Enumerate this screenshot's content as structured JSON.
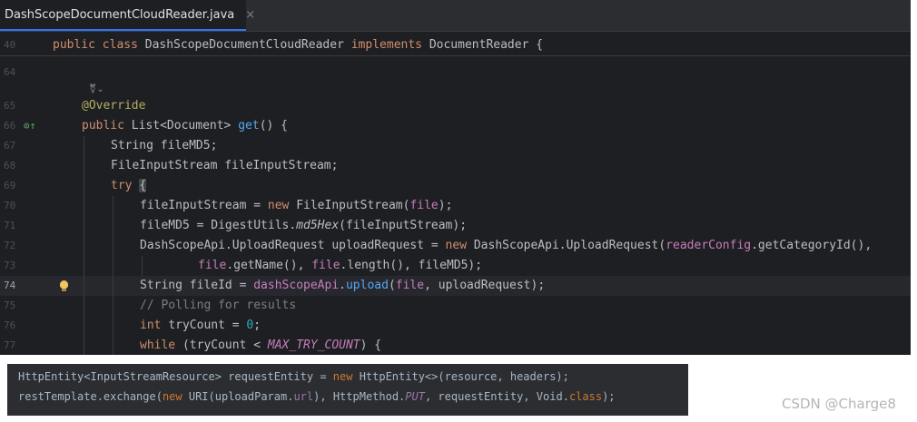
{
  "tab": {
    "title": "DashScopeDocumentCloudReader.java",
    "close": "×",
    "active": true
  },
  "sticky": {
    "line_no": "40",
    "code": "public class DashScopeDocumentCloudReader implements DocumentReader {"
  },
  "usages_hint": "⚧⌄",
  "current_line": "74",
  "lines": [
    {
      "no": "64",
      "code": ""
    },
    {
      "no": "65",
      "code": "@Override"
    },
    {
      "no": "66",
      "code": "public List<Document> get() {"
    },
    {
      "no": "67",
      "code": "String fileMD5;"
    },
    {
      "no": "68",
      "code": "FileInputStream fileInputStream;"
    },
    {
      "no": "69",
      "code": "try {"
    },
    {
      "no": "70",
      "code": "fileInputStream = new FileInputStream(file);"
    },
    {
      "no": "71",
      "code": "fileMD5 = DigestUtils.md5Hex(fileInputStream);"
    },
    {
      "no": "72",
      "code": "DashScopeApi.UploadRequest uploadRequest = new DashScopeApi.UploadRequest(readerConfig.getCategoryId(),"
    },
    {
      "no": "73",
      "code": "file.getName(), file.length(), fileMD5);"
    },
    {
      "no": "74",
      "code": "String fileId = dashScopeApi.upload(file, uploadRequest);"
    },
    {
      "no": "75",
      "code": "// Polling for results"
    },
    {
      "no": "76",
      "code": "int tryCount = 0;"
    },
    {
      "no": "77",
      "code": "while (tryCount < MAX_TRY_COUNT) {"
    }
  ],
  "snippet": [
    "HttpEntity<InputStreamResource> requestEntity = new HttpEntity<>(resource, headers);",
    "restTemplate.exchange(new URI(uploadParam.url), HttpMethod.PUT, requestEntity, Void.class);"
  ],
  "watermark": "CSDN @Charge8",
  "colors": {
    "editor_bg": "#1e1f22",
    "keyword": "#cf8e6d",
    "function": "#56a8f5",
    "field": "#c77dbb",
    "annotation": "#b3ae60",
    "number": "#2aacb8",
    "comment": "#7a7e85"
  }
}
